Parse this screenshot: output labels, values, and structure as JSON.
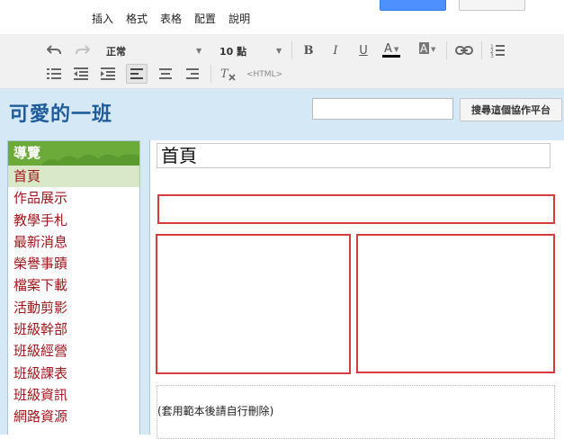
{
  "menu": {
    "items": [
      "插入",
      "格式",
      "表格",
      "配置",
      "說明"
    ]
  },
  "toolbar": {
    "style_select": "正常",
    "size_select": "10 點",
    "html_label": "<HTML>"
  },
  "site": {
    "title": "可愛的一班",
    "search_placeholder": "",
    "search_button": "搜尋這個協作平台"
  },
  "nav": {
    "heading": "導覽",
    "items": [
      "首頁",
      "作品展示",
      "教學手札",
      "最新消息",
      "榮譽事蹟",
      "檔案下載",
      "活動剪影",
      "班級幹部",
      "班級經營",
      "班級課表",
      "班級資訊",
      "網路資源"
    ],
    "active_index": 0
  },
  "content": {
    "page_title": "首頁",
    "template_note": "(套用範本後請自行刪除)"
  },
  "colors": {
    "header_bg": "#d5e8f6",
    "nav_heading_bg": "#6caa3a",
    "nav_link": "#a3141b",
    "site_title": "#1f5c9c",
    "layout_box_border": "#d63c3c"
  }
}
